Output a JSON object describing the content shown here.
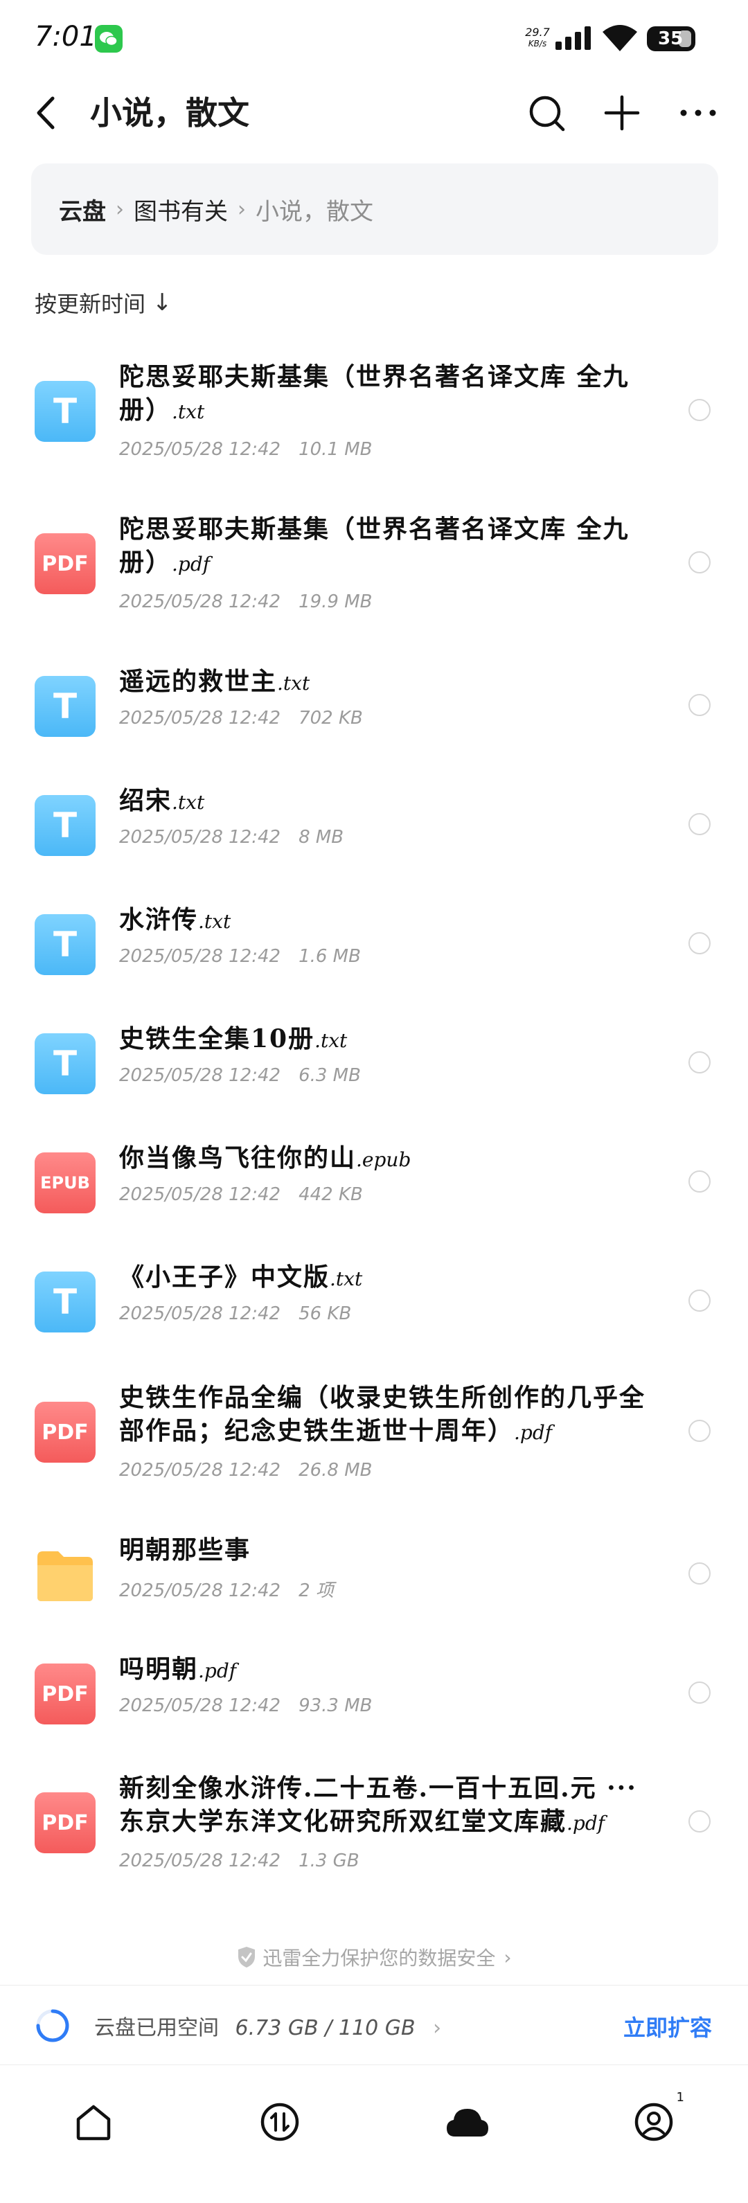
{
  "status_bar": {
    "time": "7:01",
    "net_speed_value": "29.7",
    "net_speed_unit": "KB/s",
    "battery": "35"
  },
  "header": {
    "title": "小说，散文"
  },
  "breadcrumb": {
    "items": [
      "云盘",
      "图书有关",
      "小说，散文"
    ]
  },
  "sort": {
    "label": "按更新时间",
    "arrow": "↓"
  },
  "files": [
    {
      "type": "txt",
      "icon_label": "T",
      "name": "陀思妥耶夫斯基集（世界名著名译文库 全九册）",
      "ext": ".txt",
      "date": "2025/05/28 12:42",
      "size": "10.1 MB"
    },
    {
      "type": "pdf",
      "icon_label": "PDF",
      "name": "陀思妥耶夫斯基集（世界名著名译文库 全九册）",
      "ext": ".pdf",
      "date": "2025/05/28 12:42",
      "size": "19.9 MB"
    },
    {
      "type": "txt",
      "icon_label": "T",
      "name": "遥远的救世主",
      "ext": ".txt",
      "date": "2025/05/28 12:42",
      "size": "702 KB"
    },
    {
      "type": "txt",
      "icon_label": "T",
      "name": "绍宋",
      "ext": ".txt",
      "date": "2025/05/28 12:42",
      "size": "8 MB"
    },
    {
      "type": "txt",
      "icon_label": "T",
      "name": "水浒传",
      "ext": ".txt",
      "date": "2025/05/28 12:42",
      "size": "1.6 MB"
    },
    {
      "type": "txt",
      "icon_label": "T",
      "name": "史铁生全集10册",
      "ext": ".txt",
      "date": "2025/05/28 12:42",
      "size": "6.3 MB"
    },
    {
      "type": "epub",
      "icon_label": "EPUB",
      "name": "你当像鸟飞往你的山",
      "ext": ".epub",
      "date": "2025/05/28 12:42",
      "size": "442 KB"
    },
    {
      "type": "txt",
      "icon_label": "T",
      "name": "《小王子》中文版",
      "ext": ".txt",
      "date": "2025/05/28 12:42",
      "size": "56 KB"
    },
    {
      "type": "pdf",
      "icon_label": "PDF",
      "name": "史铁生作品全编（收录史铁生所创作的几乎全部作品；纪念史铁生逝世十周年）",
      "ext": ".pdf",
      "date": "2025/05/28 12:42",
      "size": "26.8 MB"
    },
    {
      "type": "folder",
      "icon_label": "",
      "name": "明朝那些事",
      "ext": "",
      "date": "2025/05/28 12:42",
      "size": "2 项"
    },
    {
      "type": "pdf",
      "icon_label": "PDF",
      "name": "吗明朝",
      "ext": ".pdf",
      "date": "2025/05/28 12:42",
      "size": "93.3 MB"
    },
    {
      "type": "pdf",
      "icon_label": "PDF",
      "name": "新刻全像水浒传.二十五卷.一百十五回.元 ··· 东京大学东洋文化研究所双红堂文库藏",
      "ext": ".pdf",
      "date": "2025/05/28 12:42",
      "size": "1.3 GB"
    }
  ],
  "security_note": "迅雷全力保护您的数据安全",
  "storage": {
    "label": "云盘已用空间",
    "used": "6.73 GB",
    "total": "110 GB",
    "used_fraction": 0.061,
    "expand_label": "立即扩容"
  },
  "bottom_nav": {
    "items": [
      "home-icon",
      "transfer-icon",
      "cloud-icon",
      "profile-icon"
    ],
    "profile_badge": "1"
  },
  "colors": {
    "accent": "#2f7cf6",
    "txt_icon": "#4bb8f7",
    "pdf_icon": "#f45b5b",
    "folder_icon": "#ffc14d",
    "wechat": "#2dc84d"
  }
}
